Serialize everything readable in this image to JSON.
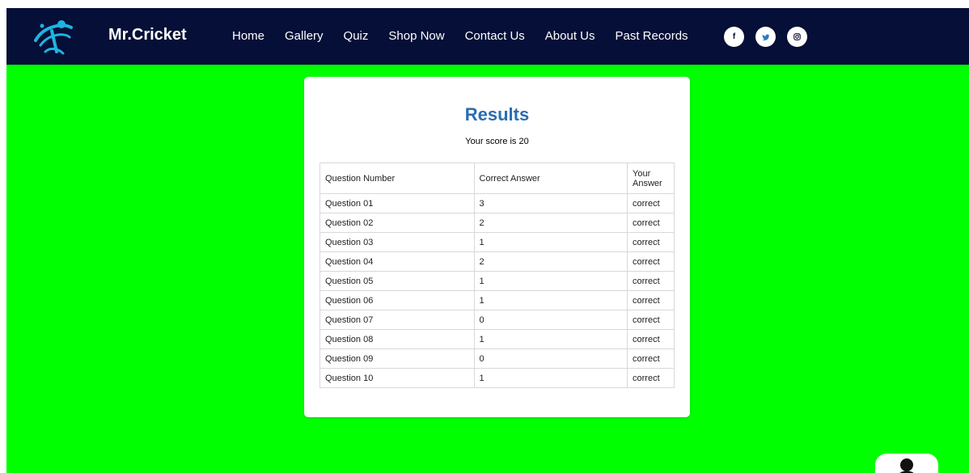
{
  "navbar": {
    "brand": "Mr.Cricket",
    "links": [
      {
        "label": "Home"
      },
      {
        "label": "Gallery"
      },
      {
        "label": "Quiz"
      },
      {
        "label": "Shop Now"
      },
      {
        "label": "Contact Us"
      },
      {
        "label": "About Us"
      },
      {
        "label": "Past Records"
      }
    ],
    "social": [
      {
        "icon": "facebook-icon",
        "glyph": "f"
      },
      {
        "icon": "twitter-icon",
        "glyph": ""
      },
      {
        "icon": "instagram-icon",
        "glyph": ""
      }
    ]
  },
  "results": {
    "title": "Results",
    "score_text": "Your score is 20",
    "columns": [
      "Question Number",
      "Correct Answer",
      "Your Answer"
    ],
    "rows": [
      {
        "question": "Question 01",
        "correct": "3",
        "your": "correct"
      },
      {
        "question": "Question 02",
        "correct": "2",
        "your": "correct"
      },
      {
        "question": "Question 03",
        "correct": "1",
        "your": "correct"
      },
      {
        "question": "Question 04",
        "correct": "2",
        "your": "correct"
      },
      {
        "question": "Question 05",
        "correct": "1",
        "your": "correct"
      },
      {
        "question": "Question 06",
        "correct": "1",
        "your": "correct"
      },
      {
        "question": "Question 07",
        "correct": "0",
        "your": "correct"
      },
      {
        "question": "Question 08",
        "correct": "1",
        "your": "correct"
      },
      {
        "question": "Question 09",
        "correct": "0",
        "your": "correct"
      },
      {
        "question": "Question 10",
        "correct": "1",
        "your": "correct"
      }
    ]
  },
  "colors": {
    "navbar_bg": "#050f37",
    "page_bg": "#00ff00",
    "title_color": "#2a6db1",
    "logo_accent": "#1fb4e0"
  }
}
